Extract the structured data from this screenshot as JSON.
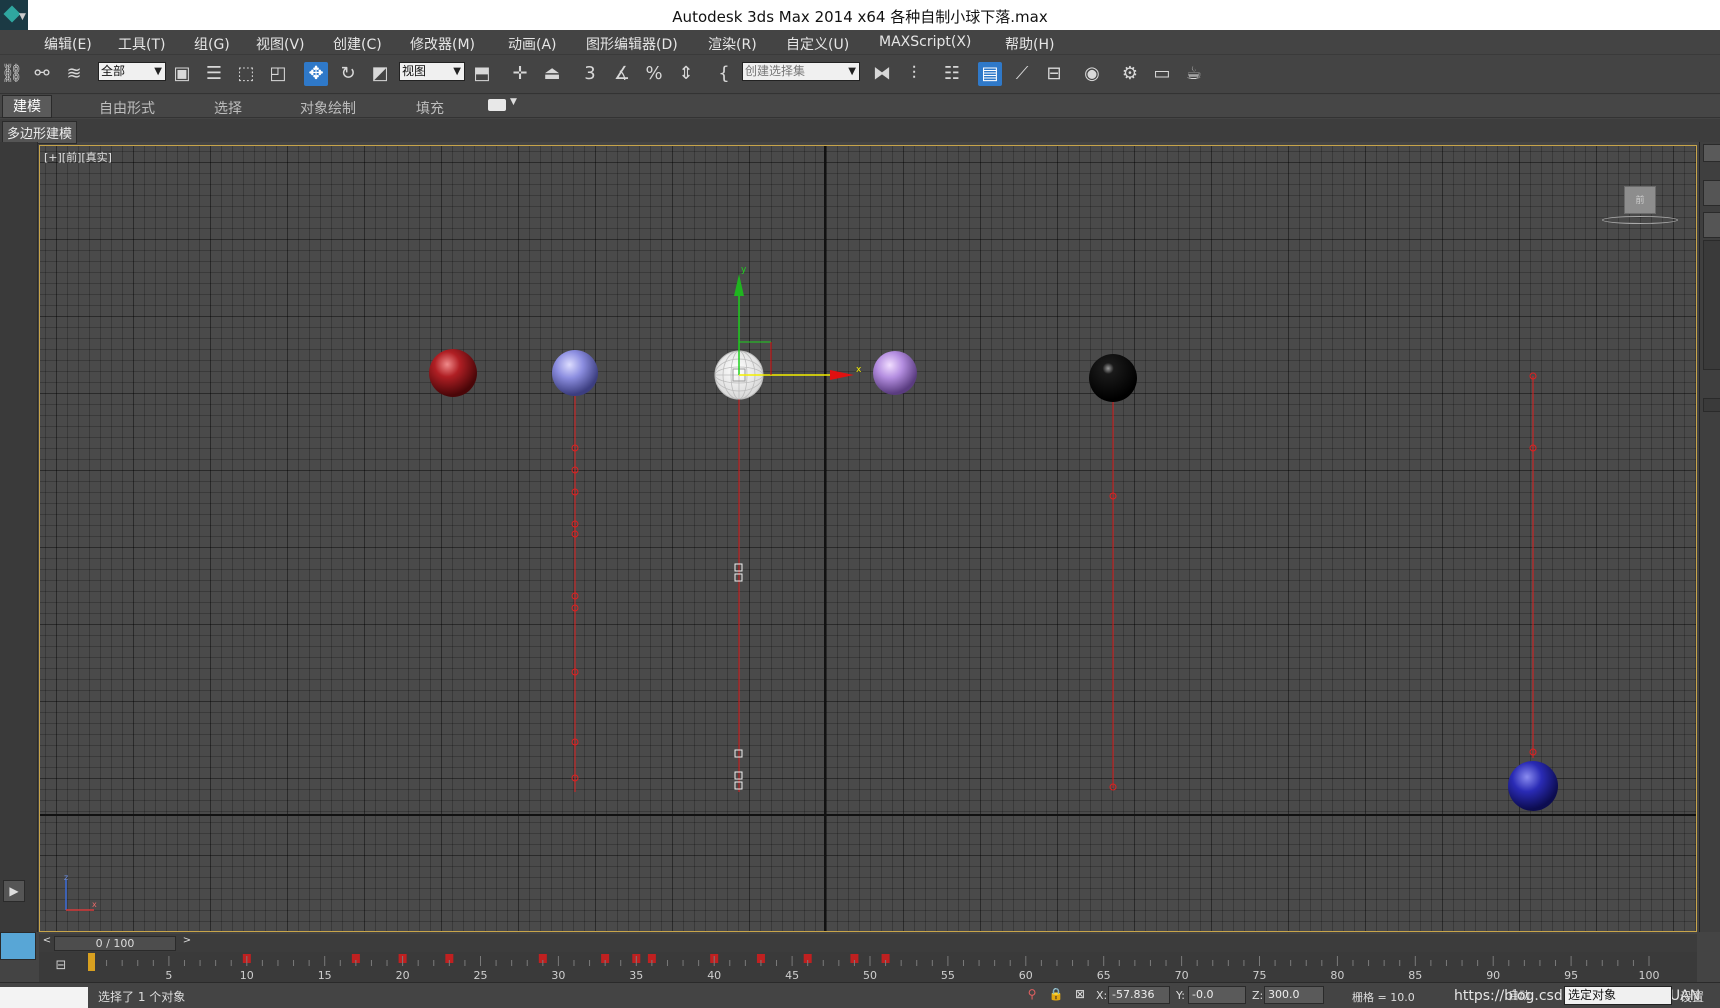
{
  "window": {
    "title": "Autodesk 3ds Max  2014 x64      各种自制小球下落.max"
  },
  "menu": {
    "items": [
      "编辑(E)",
      "工具(T)",
      "组(G)",
      "视图(V)",
      "创建(C)",
      "修改器(M)",
      "动画(A)",
      "图形编辑器(D)",
      "渲染(R)",
      "自定义(U)",
      "MAXScript(X)",
      "帮助(H)"
    ]
  },
  "toolbar": {
    "selection_filter": "全部",
    "coord_system": "视图",
    "named_selection_placeholder": "创建选择集",
    "snap_3": "3"
  },
  "ribbon": {
    "tabs": [
      "建模",
      "自由形式",
      "选择",
      "对象绘制",
      "填充"
    ],
    "sub_label": "多边形建模"
  },
  "viewport": {
    "label": "[+][前][真实]",
    "viewcube_label": "前",
    "gizmo_x": "x",
    "gizmo_y": "y",
    "world_axis_z": "z",
    "world_axis_x": "x",
    "sphere_colors": [
      "#b01f24",
      "#8c8ee0",
      "#f2f2f2",
      "#b48ee0",
      "#0a0a0a",
      "#2a2bb5"
    ]
  },
  "time_slider": {
    "value": "0 / 100",
    "current_frame": 0,
    "total_frames": 100
  },
  "timeline": {
    "tick_labels": [
      "5",
      "10",
      "15",
      "20",
      "25",
      "30",
      "35",
      "40",
      "45",
      "50",
      "55",
      "60",
      "65",
      "70",
      "75",
      "80",
      "85",
      "90",
      "95",
      "100"
    ]
  },
  "status": {
    "message": "选择了 1 个对象",
    "x_label": "X:",
    "x_value": "-57.836",
    "y_label": "Y:",
    "y_value": "-0.0",
    "z_label": "Z:",
    "z_value": "300.0",
    "grid": "栅格 = 10.0",
    "key_mode": "自动",
    "selection_set": "选定对象",
    "watermark": "https://blog.csdn.net/WARIANXUAN",
    "set_key": "设置"
  },
  "colors": {
    "active_blue": "#2f79c9",
    "viewport_border": "#c8a54a",
    "trajectory_red": "#e02020"
  }
}
